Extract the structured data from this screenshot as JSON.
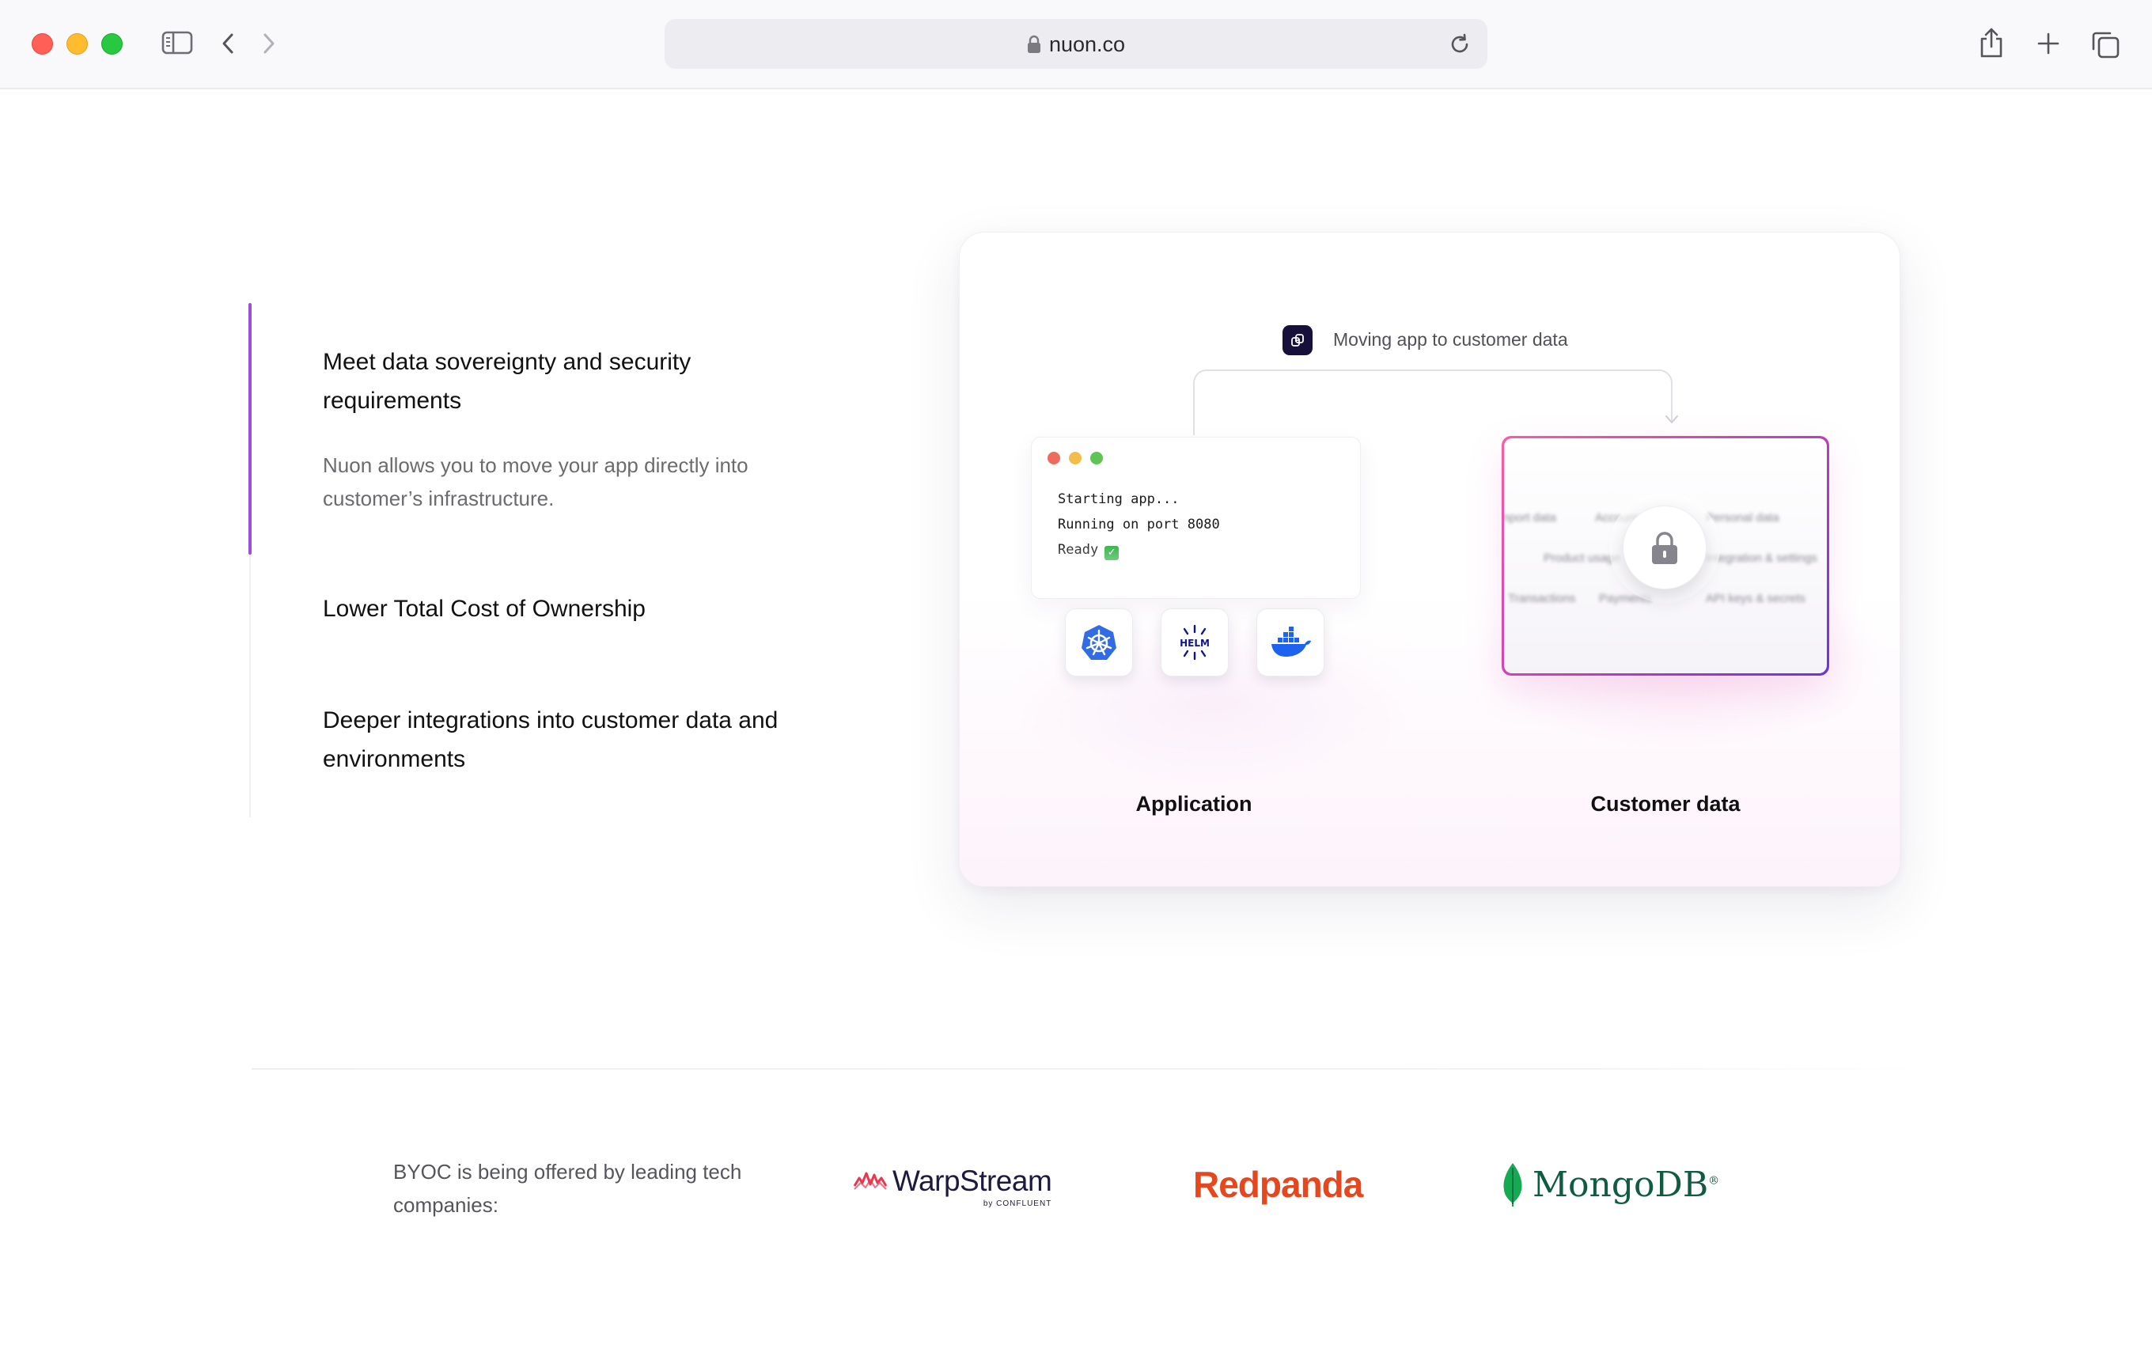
{
  "browser": {
    "url": "nuon.co",
    "icons": {
      "sidebar": "sidebar-toggle-icon",
      "back": "chevron-left-icon",
      "forward": "chevron-right-icon",
      "lock": "lock-icon",
      "reload": "reload-icon",
      "share": "share-icon",
      "new_tab": "plus-icon",
      "tabs": "tab-overview-icon"
    }
  },
  "features": {
    "active_index": 0,
    "items": [
      {
        "title": "Meet data sovereignty and security requirements",
        "description": "Nuon allows you to move your app directly into customer’s infrastructure."
      },
      {
        "title": "Lower Total Cost of Ownership"
      },
      {
        "title": "Deeper integrations into customer data and environments"
      }
    ],
    "accent_color": "#9a4fe0"
  },
  "illustration": {
    "header": "Moving app to customer data",
    "terminal_lines": [
      "Starting app...",
      "Running on port 8080",
      "Ready"
    ],
    "tools": [
      "kubernetes-icon",
      "helm-icon",
      "docker-icon"
    ],
    "helm_label": "HELM",
    "data_labels": [
      "Import data",
      "Account",
      "Personal data",
      "Product usage",
      "Integration & settings",
      "Transactions",
      "Payments",
      "API keys & secrets"
    ],
    "application_label": "Application",
    "customer_data_label": "Customer data"
  },
  "companies": {
    "intro": "BYOC is being offered by leading tech companies:",
    "logos": [
      {
        "name": "WarpStream",
        "sub": "by CONFLUENT",
        "color": "#1d1b3d"
      },
      {
        "name": "Redpanda",
        "color": "#e5481f"
      },
      {
        "name": "MongoDB",
        "color": "#0f5c40"
      }
    ]
  }
}
